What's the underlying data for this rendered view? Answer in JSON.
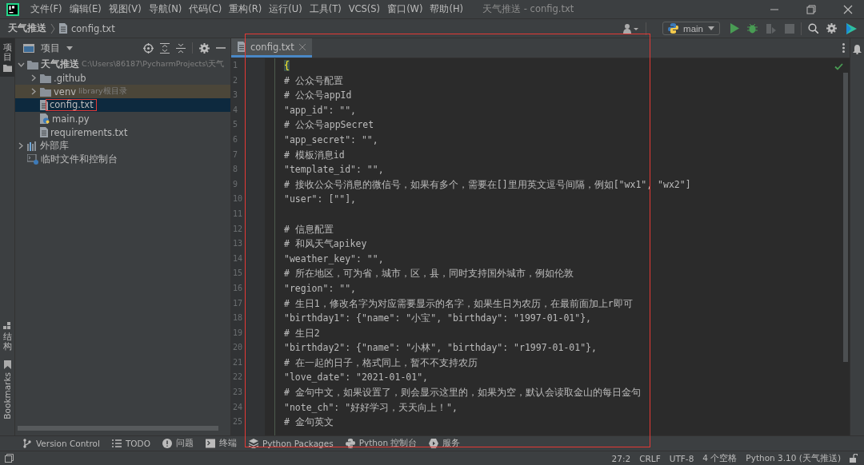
{
  "window": {
    "title": "天气推送 - config.txt"
  },
  "menu": [
    "文件(F)",
    "编辑(E)",
    "视图(V)",
    "导航(N)",
    "代码(C)",
    "重构(R)",
    "运行(U)",
    "工具(T)",
    "VCS(S)",
    "窗口(W)",
    "帮助(H)"
  ],
  "breadcrumb": [
    "天气推送",
    "config.txt"
  ],
  "run_config": {
    "label": "main"
  },
  "run_actions": [
    {
      "kind": "run",
      "disabled": false
    },
    {
      "kind": "debug",
      "disabled": false
    },
    {
      "kind": "coverage",
      "disabled": true
    },
    {
      "kind": "stop",
      "disabled": true
    }
  ],
  "left_stripe": [
    {
      "label": "项目",
      "kind": "project",
      "selected": true
    },
    {
      "label": "结构",
      "kind": "structure",
      "selected": false
    },
    {
      "label": "Bookmarks",
      "kind": "bookmarks",
      "selected": false
    }
  ],
  "project_panel": {
    "title": "项目",
    "tree": [
      {
        "label": "天气推送",
        "hint": "C:\\Users\\86187\\PycharmProjects\\天气",
        "kind": "project",
        "expanded": true,
        "selected": false,
        "annotated": false,
        "children": [
          {
            "label": ".github",
            "kind": "folder",
            "expanded": false,
            "selected": false,
            "annotated": false
          },
          {
            "label": "venv",
            "hint": "library根目录",
            "kind": "library-folder",
            "expanded": false,
            "selected": false,
            "annotated": false
          },
          {
            "label": "config.txt",
            "kind": "text-file",
            "selected": true,
            "annotated": true
          },
          {
            "label": "main.py",
            "kind": "python-file",
            "selected": false,
            "annotated": false
          },
          {
            "label": "requirements.txt",
            "kind": "text-file",
            "selected": false,
            "annotated": false
          }
        ]
      },
      {
        "label": "外部库",
        "kind": "libraries",
        "expanded": false,
        "selected": false,
        "annotated": false
      },
      {
        "label": "临时文件和控制台",
        "kind": "scratches",
        "selected": false,
        "annotated": false
      }
    ]
  },
  "editor": {
    "annotated": true,
    "tabs": [
      {
        "label": "config.txt",
        "selected": true
      }
    ],
    "lines": [
      {
        "number": "1",
        "text": "{",
        "kind": "brace"
      },
      {
        "number": "2",
        "text": "# 公众号配置",
        "kind": "text"
      },
      {
        "number": "3",
        "text": "# 公众号appId",
        "kind": "text"
      },
      {
        "number": "4",
        "text": "\"app_id\": \"\",",
        "kind": "text"
      },
      {
        "number": "5",
        "text": "# 公众号appSecret",
        "kind": "text"
      },
      {
        "number": "6",
        "text": "\"app_secret\": \"\",",
        "kind": "text"
      },
      {
        "number": "7",
        "text": "# 模板消息id",
        "kind": "text"
      },
      {
        "number": "8",
        "text": "\"template_id\": \"\",",
        "kind": "text"
      },
      {
        "number": "9",
        "text": "# 接收公众号消息的微信号，如果有多个，需要在[]里用英文逗号间隔，例如[\"wx1\", \"wx2\"]",
        "kind": "text"
      },
      {
        "number": "10",
        "text": "\"user\": [\"\"],",
        "kind": "text"
      },
      {
        "number": "11",
        "kind": "blank"
      },
      {
        "number": "12",
        "text": "# 信息配置",
        "kind": "text"
      },
      {
        "number": "13",
        "text": "# 和风天气apikey",
        "kind": "text"
      },
      {
        "number": "14",
        "text": "\"weather_key\": \"\",",
        "kind": "text"
      },
      {
        "number": "15",
        "text": "# 所在地区，可为省，城市，区，县，同时支持国外城市，例如伦敦",
        "kind": "text"
      },
      {
        "number": "16",
        "text": "\"region\": \"\",",
        "kind": "text"
      },
      {
        "number": "17",
        "text": "# 生日1，修改名字为对应需要显示的名字，如果生日为农历，在最前面加上r即可",
        "kind": "text"
      },
      {
        "number": "18",
        "text": "\"birthday1\": {\"name\": \"小宝\", \"birthday\": \"1997-01-01\"},",
        "kind": "text"
      },
      {
        "number": "19",
        "text": "# 生日2",
        "kind": "text"
      },
      {
        "number": "20",
        "text": "\"birthday2\": {\"name\": \"小林\", \"birthday\": \"r1997-01-01\"},",
        "kind": "text"
      },
      {
        "number": "21",
        "text": "# 在一起的日子，格式同上，暂不不支持农历",
        "kind": "text"
      },
      {
        "number": "22",
        "text": "\"love_date\": \"2021-01-01\",",
        "kind": "text"
      },
      {
        "number": "23",
        "text": "# 金句中文，如果设置了，则会显示这里的，如果为空，默认会读取金山的每日金句",
        "kind": "text"
      },
      {
        "number": "24",
        "text": "\"note_ch\": \"好好学习，天天向上！\",",
        "kind": "text"
      },
      {
        "number": "25",
        "text": "# 金句英文",
        "kind": "text"
      }
    ]
  },
  "tool_windows": [
    {
      "label": "Version Control",
      "kind": "vcs"
    },
    {
      "label": "TODO",
      "kind": "todo"
    },
    {
      "label": "问题",
      "kind": "problems"
    },
    {
      "label": "终端",
      "kind": "terminal"
    },
    {
      "label": "Python Packages",
      "kind": "packages"
    },
    {
      "label": "Python 控制台",
      "kind": "console"
    },
    {
      "label": "服务",
      "kind": "services"
    }
  ],
  "status_bar": [
    "27:2",
    "CRLF",
    "UTF-8",
    "4 个空格",
    "Python 3.10 (天气推送)"
  ]
}
